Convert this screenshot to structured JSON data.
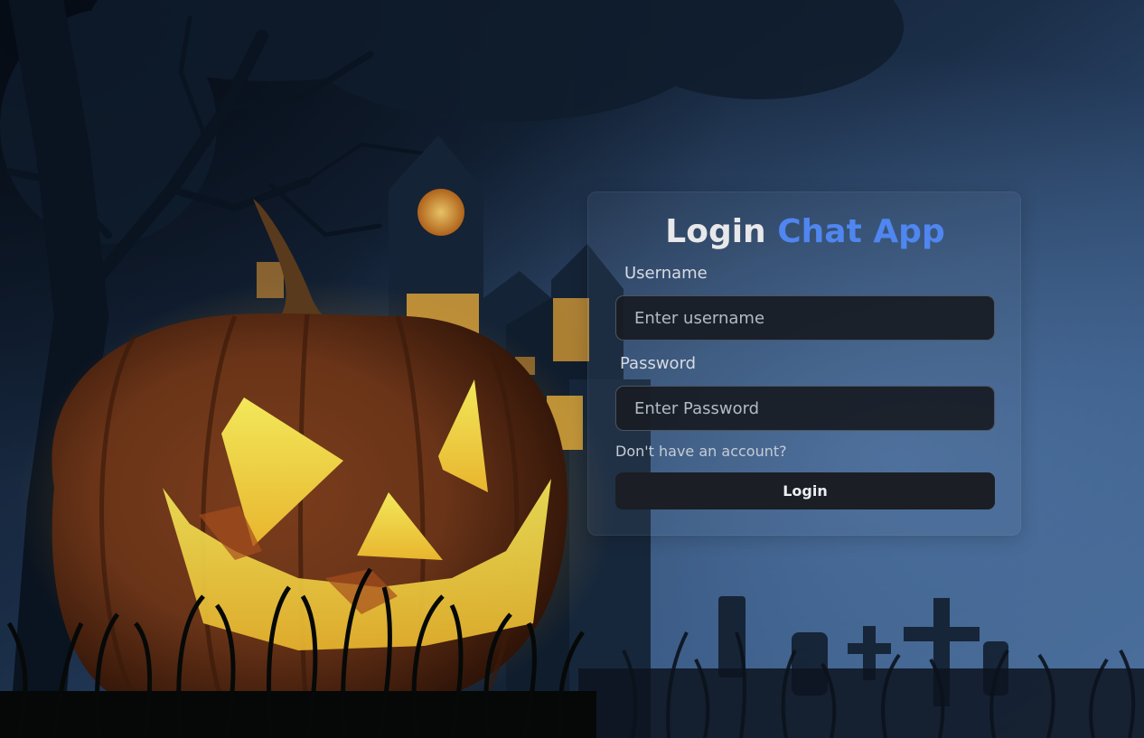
{
  "login_form": {
    "title_prefix": "Login",
    "title_accent": "Chat App",
    "accent_color": "#4f86f0",
    "username_label": "Username",
    "username_placeholder": "Enter username",
    "username_value": "",
    "password_label": "Password",
    "password_placeholder": "Enter Password",
    "password_value": "",
    "signup_link": "Don't have an account?",
    "submit_label": "Login"
  },
  "background": {
    "scene": "halloween-night",
    "icons": [
      "jack-o-lantern",
      "haunted-house",
      "tombstone-cross",
      "bare-tree"
    ]
  }
}
